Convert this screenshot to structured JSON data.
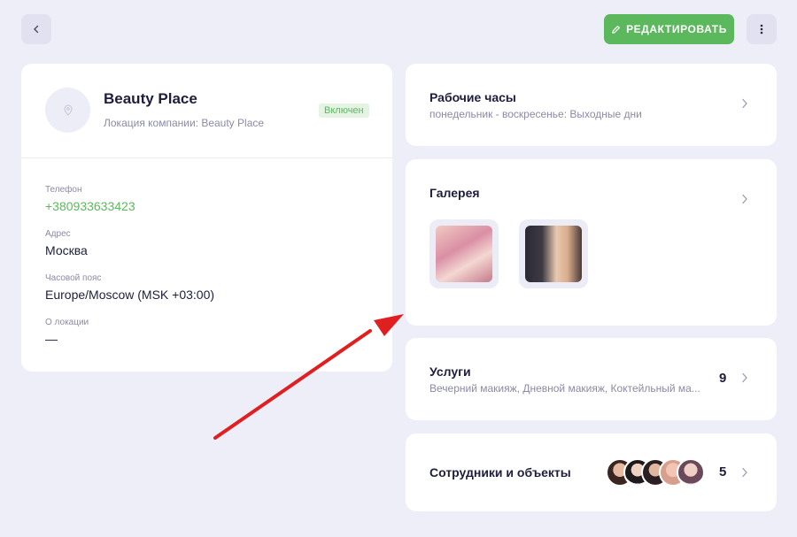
{
  "toolbar": {
    "back_icon": "chevron-left-icon",
    "edit_label": "РЕДАКТИРОВАТЬ",
    "edit_icon": "pencil-icon",
    "more_icon": "more-vertical-icon",
    "edit_color": "#5cb85c"
  },
  "location": {
    "name": "Beauty Place",
    "subtitle": "Локация компании: Beauty Place",
    "status_badge": "Включен",
    "avatar_icon": "map-pin-icon",
    "fields": [
      {
        "label": "Телефон",
        "value": "+380933633423"
      },
      {
        "label": "Адрес",
        "value": "Москва"
      },
      {
        "label": "Часовой пояс",
        "value": "Europe/Moscow (MSK +03:00)"
      },
      {
        "label": "О локации",
        "value": "—"
      }
    ]
  },
  "working_hours": {
    "title": "Рабочие часы",
    "subtitle": "понедельник - воскресенье: Выходные дни"
  },
  "gallery": {
    "title": "Галерея",
    "images": [
      "makeup-application-photo",
      "woman-makeup-portrait-photo"
    ]
  },
  "services": {
    "title": "Услуги",
    "subtitle": "Вечерний макияж, Дневной макияж, Коктейльный ма...",
    "count": "9"
  },
  "staff": {
    "title": "Сотрудники и объекты",
    "count": "5",
    "avatars": [
      "staff-avatar-1",
      "staff-avatar-2",
      "staff-avatar-3",
      "staff-avatar-4",
      "staff-avatar-5"
    ]
  },
  "annotation": {
    "arrow_color": "#e02020"
  }
}
